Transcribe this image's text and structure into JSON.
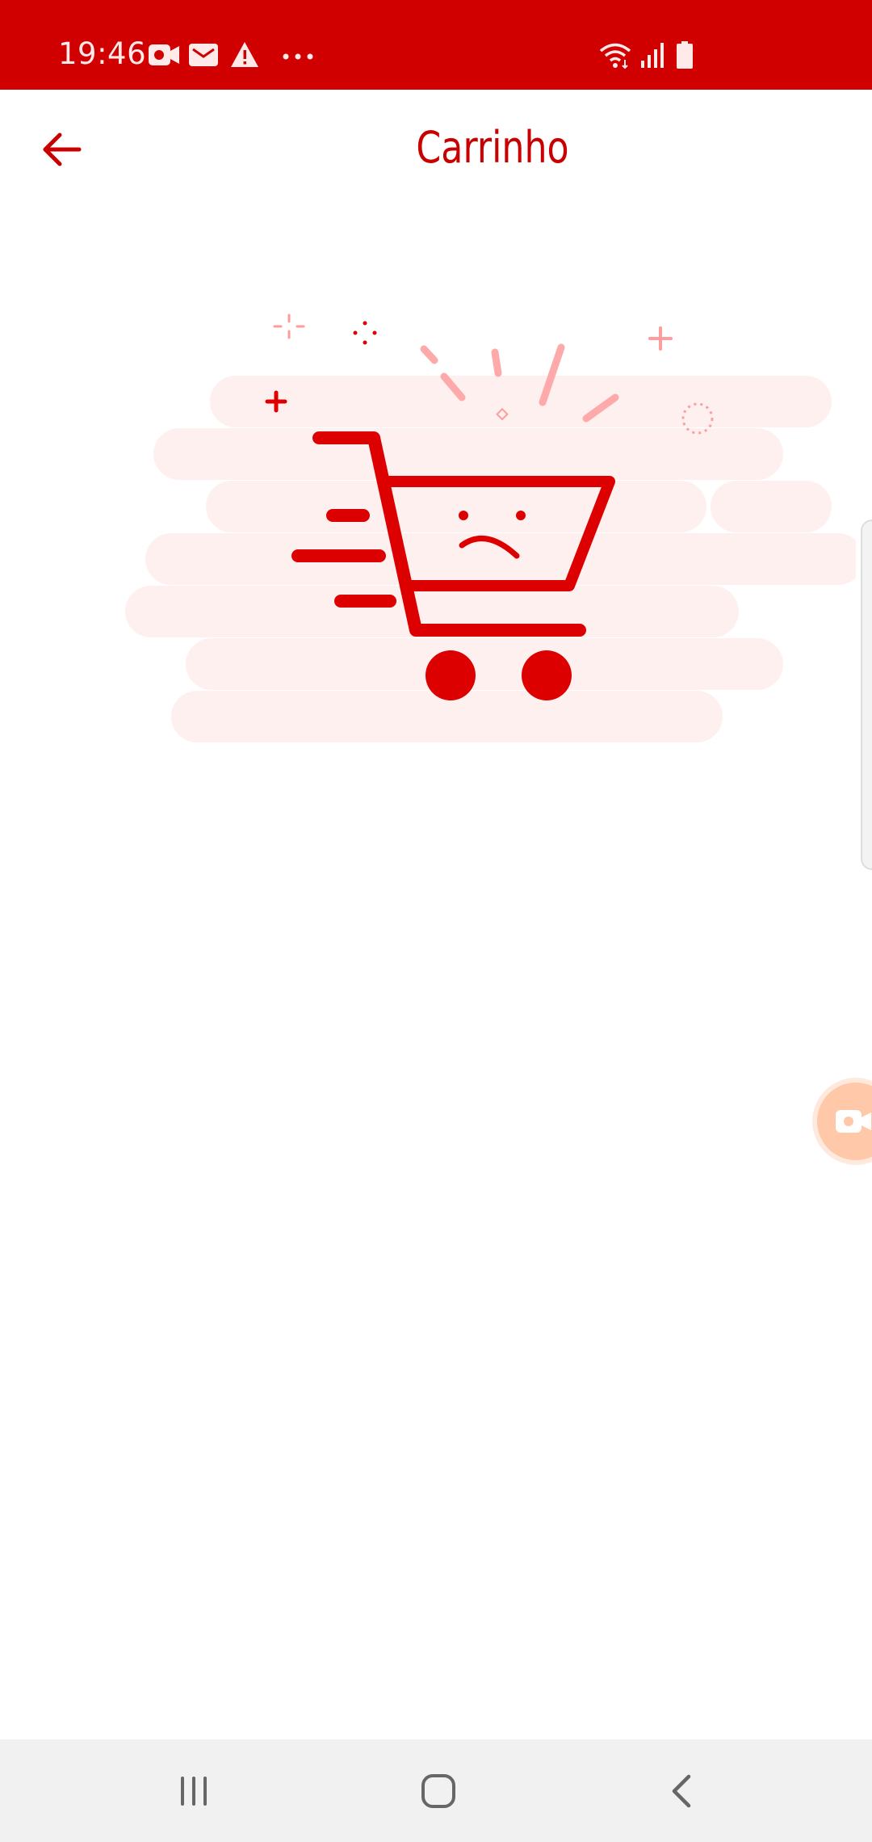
{
  "status_bar": {
    "time": "19:46",
    "left_icons": [
      "screen-recorder-icon",
      "mail-icon",
      "warning-icon",
      "more-dots-icon"
    ],
    "right_icons": [
      "wifi-icon",
      "signal-icon",
      "battery-icon"
    ],
    "background": "#d10000"
  },
  "app_bar": {
    "title": "Carrinho",
    "back_icon": "arrow-left-icon",
    "accent": "#c90000"
  },
  "empty_state": {
    "illustration": "sad-shopping-cart-illustration",
    "primary_color": "#dd0000",
    "highlight_color": "#ff9c9c",
    "background_color": "#fff0f0"
  },
  "floating_button": {
    "icon": "screen-recorder-icon",
    "color": "#ffc8a8"
  },
  "nav_bar": {
    "buttons": [
      "recent-apps-icon",
      "home-icon",
      "back-icon"
    ]
  }
}
